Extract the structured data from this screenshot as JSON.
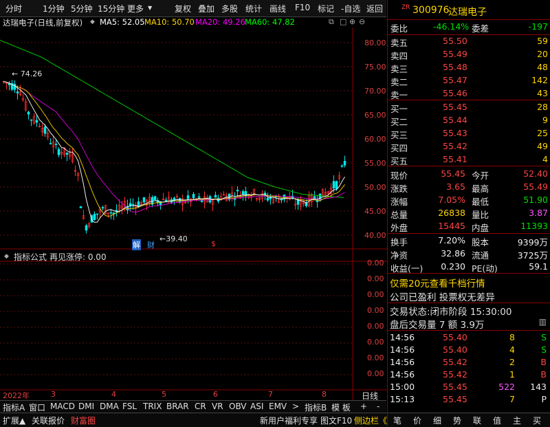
{
  "toolbar": {
    "items": [
      "分时",
      "1分钟",
      "5分钟",
      "15分钟",
      "更多",
      "复权",
      "叠加",
      "多股",
      "统计",
      "画线",
      "F10",
      "标记",
      "-自选",
      "返回"
    ]
  },
  "chart_header": {
    "title": "达瑞电子(日线,前复权)",
    "ma5": "MA5: 52.05",
    "ma10": "MA10: 50.70",
    "ma20": "MA20: 49.26",
    "ma60": "MA60: 47.82"
  },
  "main_chart": {
    "y_labels": [
      "80.00",
      "75.00",
      "70.00",
      "65.00",
      "60.00",
      "55.00",
      "50.00",
      "45.00",
      "40.00"
    ],
    "high_mark": "74.26",
    "low_mark": "39.40",
    "event_tags": [
      "解",
      "财",
      "$"
    ]
  },
  "indicator": {
    "name": "指标公式",
    "text": "再见涨停: 0.00",
    "y_labels": [
      "0.00",
      "0.00",
      "0.00",
      "0.00",
      "0.00",
      "0.00",
      "0.00",
      "0.00"
    ]
  },
  "x_axis": {
    "labels": [
      "2022年",
      "3",
      "4",
      "5",
      "6",
      "7",
      "8"
    ],
    "period": "日线"
  },
  "tabs_row1": [
    "指标A",
    "窗口",
    "MACD",
    "DMI",
    "DMA",
    "FSL",
    "TRIX",
    "BRAR",
    "CR",
    "VR",
    "OBV",
    "ASI",
    "EMV",
    ">",
    "指标B",
    "模 板",
    "+",
    "-"
  ],
  "tabs_row2_left": [
    "扩展▲",
    "关联报价",
    "财富圈"
  ],
  "tabs_row2_mid": [
    "新用户福利专享",
    "图文F10",
    "侧边栏《"
  ],
  "tabs_row2_right": [
    "笔",
    "价",
    "细",
    "势",
    "联",
    "值",
    "主",
    "买"
  ],
  "quote": {
    "code": "300976",
    "name": "达瑞电子",
    "weibi_label": "委比",
    "weibi": "-46.14%",
    "weicha_label": "委差",
    "weicha": "-197",
    "asks": [
      {
        "label": "卖五",
        "price": "55.50",
        "vol": "59"
      },
      {
        "label": "卖四",
        "price": "55.49",
        "vol": "20"
      },
      {
        "label": "卖三",
        "price": "55.48",
        "vol": "48"
      },
      {
        "label": "卖二",
        "price": "55.47",
        "vol": "142"
      },
      {
        "label": "卖一",
        "price": "55.46",
        "vol": "43"
      }
    ],
    "bids": [
      {
        "label": "买一",
        "price": "55.45",
        "vol": "28"
      },
      {
        "label": "买二",
        "price": "55.44",
        "vol": "9"
      },
      {
        "label": "买三",
        "price": "55.43",
        "vol": "25"
      },
      {
        "label": "买四",
        "price": "55.42",
        "vol": "49"
      },
      {
        "label": "买五",
        "price": "55.41",
        "vol": "4"
      }
    ],
    "stats": [
      {
        "l1": "现价",
        "v1": "55.45",
        "l2": "今开",
        "v2": "52.40"
      },
      {
        "l1": "涨跌",
        "v1": "3.65",
        "l2": "最高",
        "v2": "55.49"
      },
      {
        "l1": "涨幅",
        "v1": "7.05%",
        "l2": "最低",
        "v2": "51.90"
      },
      {
        "l1": "总量",
        "v1": "26838",
        "l2": "量比",
        "v2": "3.87"
      },
      {
        "l1": "外盘",
        "v1": "15445",
        "l2": "内盘",
        "v2": "11393"
      }
    ],
    "stats2": [
      {
        "l1": "换手",
        "v1": "7.20%",
        "l2": "股本",
        "v2": "9399万"
      },
      {
        "l1": "净资",
        "v1": "32.86",
        "l2": "流通",
        "v2": "3725万"
      },
      {
        "l1": "收益(一)",
        "v1": "0.230",
        "l2": "PE(动)",
        "v2": "59.1"
      }
    ],
    "promo": "仅需20元查看千档行情",
    "company_note": "公司已盈利 投票权无差异",
    "trade_status": "交易状态:闭市阶段 15:30:00",
    "after_hours": "盘后交易量 7 额 3.9万",
    "ticks": [
      {
        "t": "14:56",
        "p": "55.40",
        "v": "8",
        "s": "S"
      },
      {
        "t": "14:56",
        "p": "55.40",
        "v": "4",
        "s": "S"
      },
      {
        "t": "14:56",
        "p": "55.42",
        "v": "2",
        "s": "B"
      },
      {
        "t": "14:56",
        "p": "55.42",
        "v": "1",
        "s": "B"
      },
      {
        "t": "15:00",
        "p": "55.45",
        "v": "522",
        "s": "143"
      },
      {
        "t": "15:13",
        "p": "55.45",
        "v": "7",
        "s": "P"
      }
    ]
  },
  "colors": {
    "up": "#ff4444",
    "down": "#00e000",
    "ma5": "#ffffff",
    "ma10": "#ffd700",
    "ma20": "#ff00ff",
    "ma60": "#00ff00"
  }
}
